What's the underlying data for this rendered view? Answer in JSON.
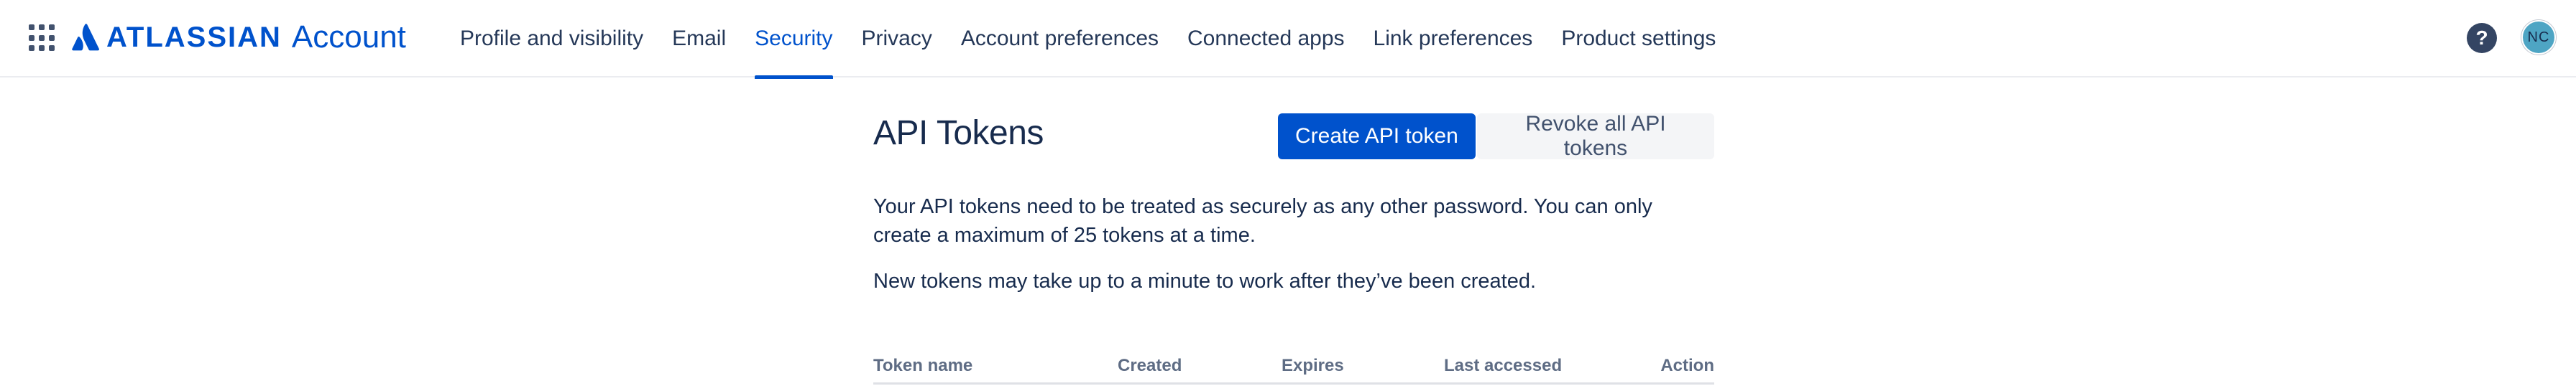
{
  "header": {
    "brand": "ATLASSIAN",
    "product": "Account",
    "tabs": [
      {
        "label": "Profile and visibility",
        "active": false
      },
      {
        "label": "Email",
        "active": false
      },
      {
        "label": "Security",
        "active": true
      },
      {
        "label": "Privacy",
        "active": false
      },
      {
        "label": "Account preferences",
        "active": false
      },
      {
        "label": "Connected apps",
        "active": false
      },
      {
        "label": "Link preferences",
        "active": false
      },
      {
        "label": "Product settings",
        "active": false
      }
    ],
    "help_icon": "question-circle-icon",
    "help_glyph": "?",
    "avatar_initials": "NC"
  },
  "main": {
    "title": "API Tokens",
    "create_button": "Create API token",
    "revoke_button": "Revoke all API tokens",
    "paragraph_1": "Your API tokens need to be treated as securely as any other password. You can only create a maximum of 25 tokens at a time.",
    "paragraph_2": "New tokens may take up to a minute to work after they’ve been created.",
    "table": {
      "columns": [
        "Token name",
        "Created",
        "Expires",
        "Last accessed",
        "Action"
      ]
    }
  },
  "colors": {
    "accent": "#0052CC",
    "text": "#172B4D",
    "muted": "#5E6C84"
  }
}
